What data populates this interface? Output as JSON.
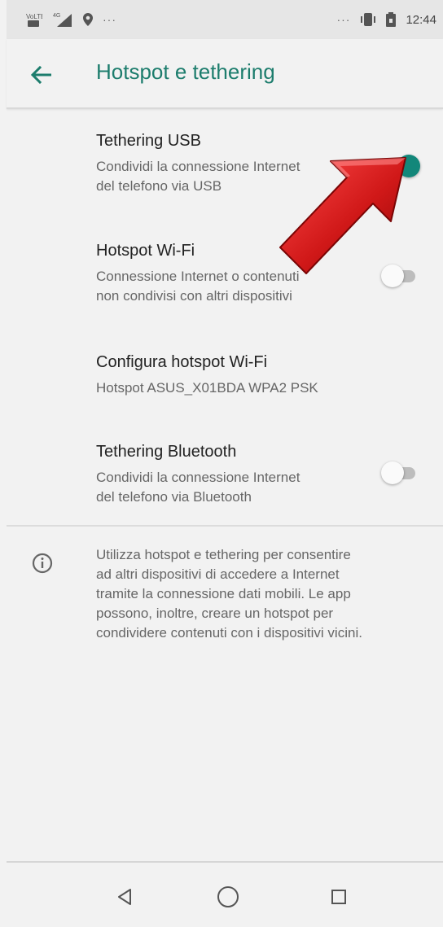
{
  "status_bar": {
    "left_icons": [
      "volte-icon",
      "signal-4g-icon",
      "location-icon"
    ],
    "left_more": "···",
    "right_more": "···",
    "right_icons": [
      "vibrate-icon",
      "lock-battery-icon"
    ],
    "time": "12:44"
  },
  "app_bar": {
    "title": "Hotspot e tethering",
    "back_icon": "arrow-back-icon"
  },
  "colors": {
    "accent": "#1d7d6d",
    "toggle_on": "#13877a",
    "arrow": "#d01818"
  },
  "items": [
    {
      "title": "Tethering USB",
      "summary_line1": "Condividi la connessione Internet",
      "summary_line2": "del telefono via USB",
      "toggle": true
    },
    {
      "title": "Hotspot Wi-Fi",
      "summary_line1": "Connessione Internet o contenuti",
      "summary_line2": "non condivisi con altri dispositivi",
      "toggle": false
    },
    {
      "title": "Configura hotspot Wi-Fi",
      "summary_line1": "Hotspot ASUS_X01BDA WPA2 PSK"
    },
    {
      "title": "Tethering Bluetooth",
      "summary_line1": "Condividi la connessione Internet",
      "summary_line2": "del telefono via Bluetooth",
      "toggle": false
    }
  ],
  "info": {
    "icon": "info-icon",
    "line1": "Utilizza hotspot e tethering per consentire",
    "line2": "ad altri dispositivi di accedere a Internet",
    "line3": "tramite la connessione dati mobili. Le app",
    "line4": "possono, inoltre, creare un hotspot per",
    "line5": "condividere contenuti con i dispositivi vicini."
  },
  "nav_bar": {
    "icons": [
      "nav-back-icon",
      "nav-home-icon",
      "nav-recents-icon"
    ]
  }
}
